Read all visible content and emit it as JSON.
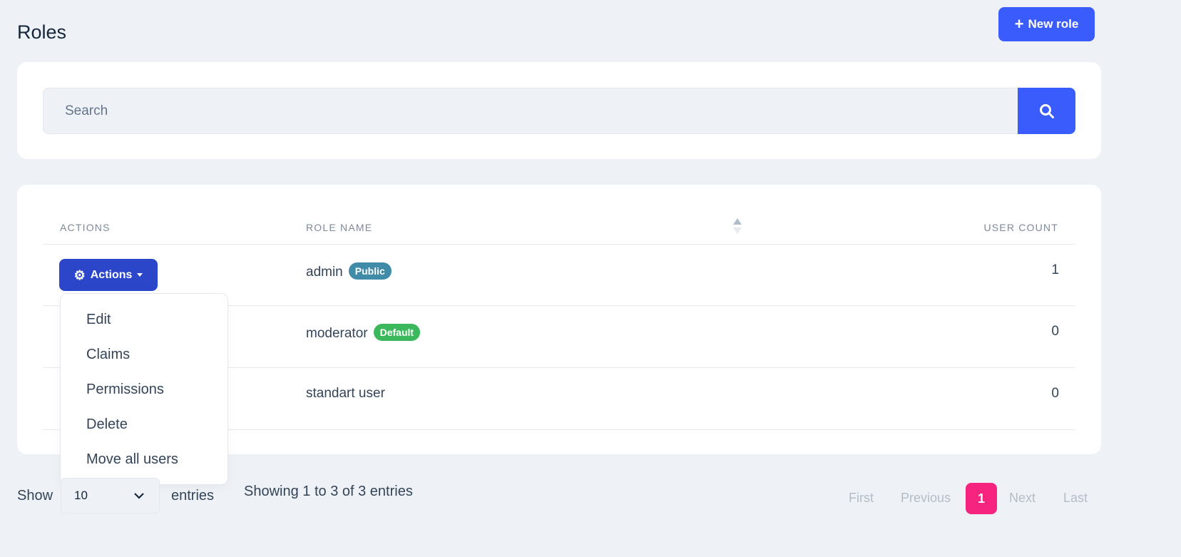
{
  "header": {
    "title": "Roles",
    "new_role_label": "New role"
  },
  "search": {
    "placeholder": "Search"
  },
  "table": {
    "columns": [
      "ACTIONS",
      "ROLE NAME",
      "USER COUNT"
    ],
    "rows": [
      {
        "name": "admin",
        "badge": "Public",
        "badge_color": "#3f8ba8",
        "count": "1"
      },
      {
        "name": "moderator",
        "badge": "Default",
        "badge_color": "#3cb85c",
        "count": "0"
      },
      {
        "name": "standart user",
        "badge": null,
        "count": "0"
      }
    ],
    "actions_label": "Actions"
  },
  "dropdown": {
    "items": [
      "Edit",
      "Claims",
      "Permissions",
      "Delete",
      "Move all users"
    ]
  },
  "footer": {
    "show": "Show",
    "page_size": "10",
    "entries": "entries",
    "info": "Showing 1 to 3 of 3 entries"
  },
  "pagination": {
    "first": "First",
    "previous": "Previous",
    "current": "1",
    "next": "Next",
    "last": "Last"
  },
  "colors": {
    "primary": "#3b5cfd",
    "actions": "#2b46c9",
    "active_page": "#f7247f",
    "background": "#eef2f6"
  }
}
